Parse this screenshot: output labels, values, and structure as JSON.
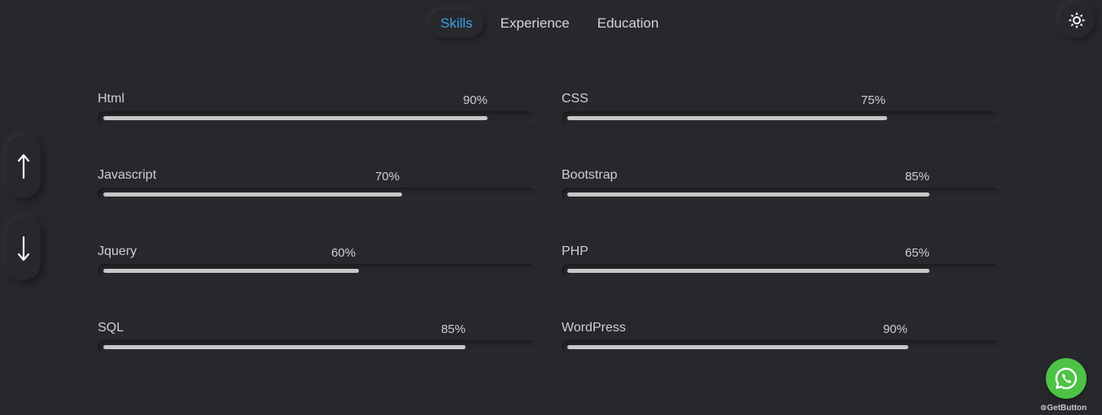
{
  "tabs": [
    {
      "label": "Skills",
      "active": true
    },
    {
      "label": "Experience",
      "active": false
    },
    {
      "label": "Education",
      "active": false
    }
  ],
  "theme_toggle": {
    "icon": "sun-icon"
  },
  "nav_arrows": {
    "up_icon": "arrow-up-icon",
    "down_icon": "arrow-down-icon"
  },
  "skills": [
    {
      "name": "Html",
      "percent_label": "90%",
      "fill": 90
    },
    {
      "name": "CSS",
      "percent_label": "75%",
      "fill": 75
    },
    {
      "name": "Javascript",
      "percent_label": "70%",
      "fill": 70
    },
    {
      "name": "Bootstrap",
      "percent_label": "85%",
      "fill": 85
    },
    {
      "name": "Jquery",
      "percent_label": "60%",
      "fill": 60
    },
    {
      "name": "PHP",
      "percent_label": "65%",
      "fill": 85
    },
    {
      "name": "SQL",
      "percent_label": "85%",
      "fill": 85
    },
    {
      "name": "WordPress",
      "percent_label": "90%",
      "fill": 80
    }
  ],
  "whatsapp": {
    "icon": "whatsapp-icon",
    "credit": "GetButton"
  },
  "colors": {
    "background": "#27282c",
    "accent": "#3aa0e8",
    "bar_fill": "#c7c7c7",
    "whatsapp_green": "#4dc247"
  }
}
